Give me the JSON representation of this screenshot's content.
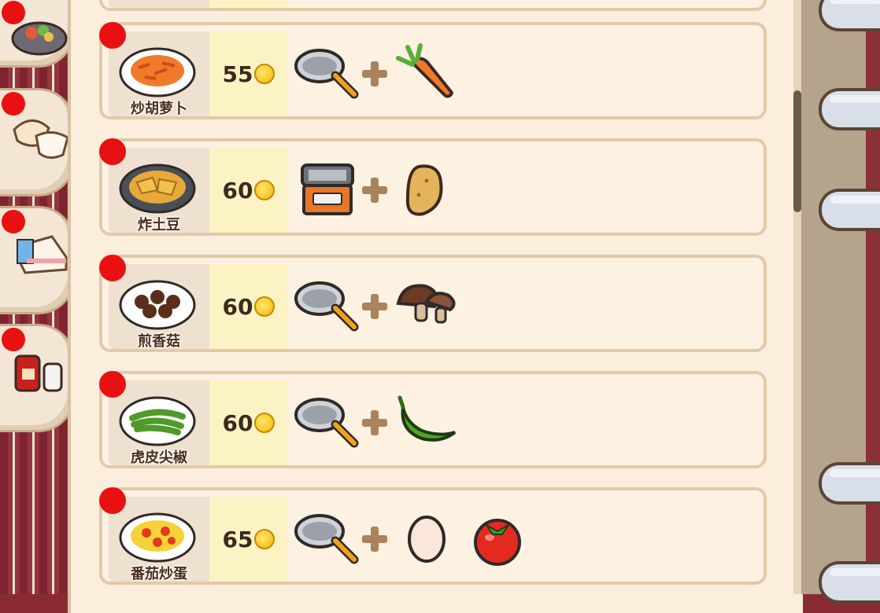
{
  "tabs": [
    {
      "name": "stir-fry-tab",
      "icon": "stir-fry-dish-icon"
    },
    {
      "name": "staple-tab",
      "icon": "rice-bowl-icon"
    },
    {
      "name": "dessert-tab",
      "icon": "cake-icon"
    },
    {
      "name": "condiment-tab",
      "icon": "sauce-bottle-icon"
    }
  ],
  "recipes": [
    {
      "name": "炒胡萝卜",
      "price": "55",
      "tool": "frying-pan-icon",
      "ingredients": [
        "carrot-icon"
      ]
    },
    {
      "name": "炸土豆",
      "price": "60",
      "tool": "deep-fryer-icon",
      "ingredients": [
        "potato-icon"
      ]
    },
    {
      "name": "煎香菇",
      "price": "60",
      "tool": "frying-pan-icon",
      "ingredients": [
        "mushroom-icon"
      ]
    },
    {
      "name": "虎皮尖椒",
      "price": "60",
      "tool": "frying-pan-icon",
      "ingredients": [
        "green-pepper-icon"
      ]
    },
    {
      "name": "番茄炒蛋",
      "price": "65",
      "tool": "frying-pan-icon",
      "ingredients": [
        "egg-icon",
        "tomato-icon"
      ]
    }
  ],
  "colors": {
    "new_badge": "#e81010",
    "coin": "#f2b705",
    "row_bg": "#fdf1e1",
    "price_bg": "#fcf3c5"
  }
}
